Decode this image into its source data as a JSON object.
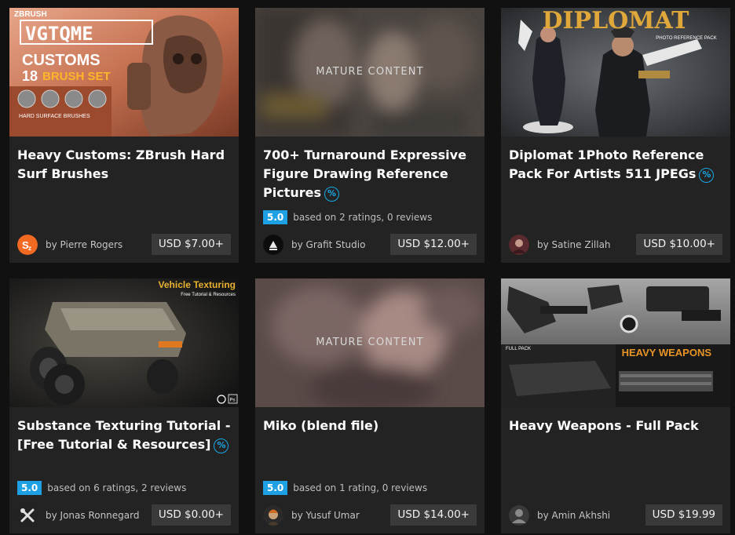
{
  "cards": [
    {
      "title": "Heavy Customs: ZBrush Hard Surf Brushes",
      "author": "by Pierre Rogers",
      "price": "USD $7.00+",
      "thumb_text": {
        "brand": "ZBRUSH",
        "logo": "VGTQME",
        "line1": "CUSTOMS",
        "count": "18",
        "count_label": "BRUSH SET",
        "footer": "HARD SURFACE BRUSHES"
      }
    },
    {
      "title": "700+ Turnaround Expressive Figure Drawing Reference Pictures",
      "mature_label": "MATURE CONTENT",
      "rating": "5.0",
      "rating_text": "based on 2 ratings, 0 reviews",
      "author": "by Grafit Studio",
      "price": "USD $12.00+"
    },
    {
      "title": "Diplomat 1Photo Reference Pack For Artists 511 JPEGs",
      "author": "by Satine Zillah",
      "price": "USD $10.00+",
      "thumb_text": {
        "headline": "DIPLOMAT",
        "sub": "PHOTO REFERENCE PACK"
      }
    },
    {
      "title": "Substance Texturing Tutorial - [Free Tutorial & Resources]",
      "rating": "5.0",
      "rating_text": "based on 6 ratings, 2 reviews",
      "author": "by Jonas Ronnegard",
      "price": "USD $0.00+",
      "thumb_text": {
        "headline": "Vehicle Texturing",
        "sub": "Free Tutorial & Resources",
        "badge": "Ps"
      }
    },
    {
      "title": "Miko (blend file)",
      "mature_label": "MATURE CONTENT",
      "rating": "5.0",
      "rating_text": "based on 1 rating, 0 reviews",
      "author": "by Yusuf Umar",
      "price": "USD $14.00+"
    },
    {
      "title": "Heavy Weapons - Full Pack",
      "author": "by Amin Akhshi",
      "price": "USD $19.99",
      "thumb_text": {
        "label_small": "FULL PACK",
        "headline": "HEAVY WEAPONS"
      }
    }
  ],
  "icons": {
    "sale": "percent-icon"
  },
  "colors": {
    "accent": "#1da1e4",
    "card_bg": "#232323",
    "page_bg": "#111111",
    "price_bg": "#3a3a3a"
  }
}
